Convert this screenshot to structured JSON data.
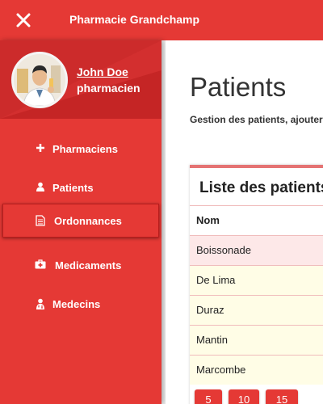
{
  "app": {
    "title": "Pharmacie Grandchamp"
  },
  "user": {
    "name": "John Doe",
    "role": "pharmacien"
  },
  "sidebar": {
    "items": [
      {
        "label": "Pharmaciens",
        "icon": "plus-icon"
      },
      {
        "label": "Patients",
        "icon": "user-icon"
      },
      {
        "label": "Ordonnances",
        "icon": "document-icon",
        "active": true
      },
      {
        "label": "Medicaments",
        "icon": "medkit-icon"
      },
      {
        "label": "Medecins",
        "icon": "doctor-icon"
      }
    ]
  },
  "main": {
    "title": "Patients",
    "subtitle": "Gestion des patients, ajouter",
    "card": {
      "title": "Liste des patients",
      "columns": [
        "Nom"
      ],
      "rows": [
        "Boissonade",
        "De Lima",
        "Duraz",
        "Mantin",
        "Marcombe"
      ],
      "page_sizes": [
        "5",
        "10",
        "15"
      ]
    }
  },
  "colors": {
    "primary": "#e53935",
    "row_bg": "#fffde6",
    "row_hover": "#fde8e8"
  }
}
